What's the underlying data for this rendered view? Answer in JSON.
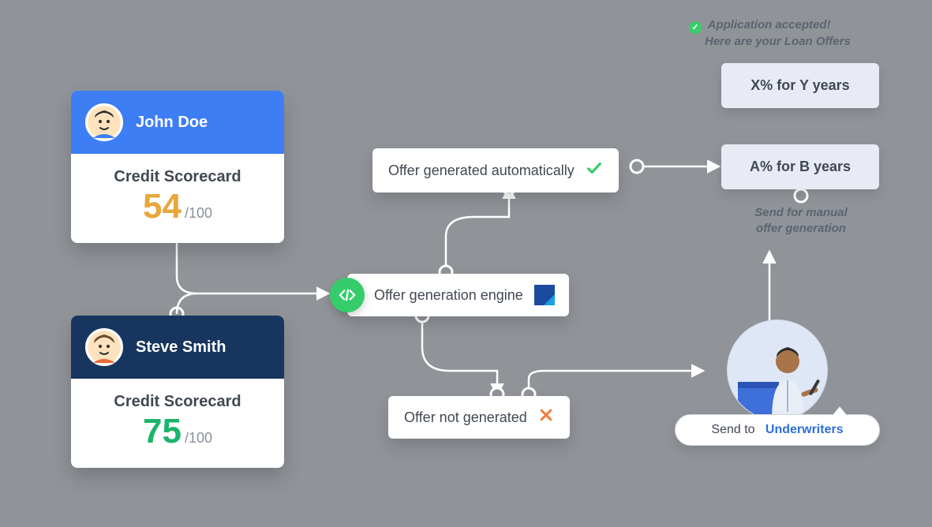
{
  "applicants": [
    {
      "name": "John Doe",
      "score_label": "Credit Scorecard",
      "score": "54",
      "out_of": "/100"
    },
    {
      "name": "Steve Smith",
      "score_label": "Credit Scorecard",
      "score": "75",
      "out_of": "/100"
    }
  ],
  "engine": {
    "label": "Offer generation engine"
  },
  "flow": {
    "generated": {
      "label": "Offer generated automatically"
    },
    "not_generated": {
      "label": "Offer not generated"
    }
  },
  "offers": [
    {
      "label": "X% for Y years"
    },
    {
      "label": "A% for B years"
    }
  ],
  "captions": {
    "accepted_line1": "Application accepted!",
    "accepted_line2": "Here are your Loan Offers",
    "manual_line1": "Send for manual",
    "manual_line2": "offer generation"
  },
  "underwriter": {
    "prefix": "Send to",
    "role": "Underwriters"
  }
}
